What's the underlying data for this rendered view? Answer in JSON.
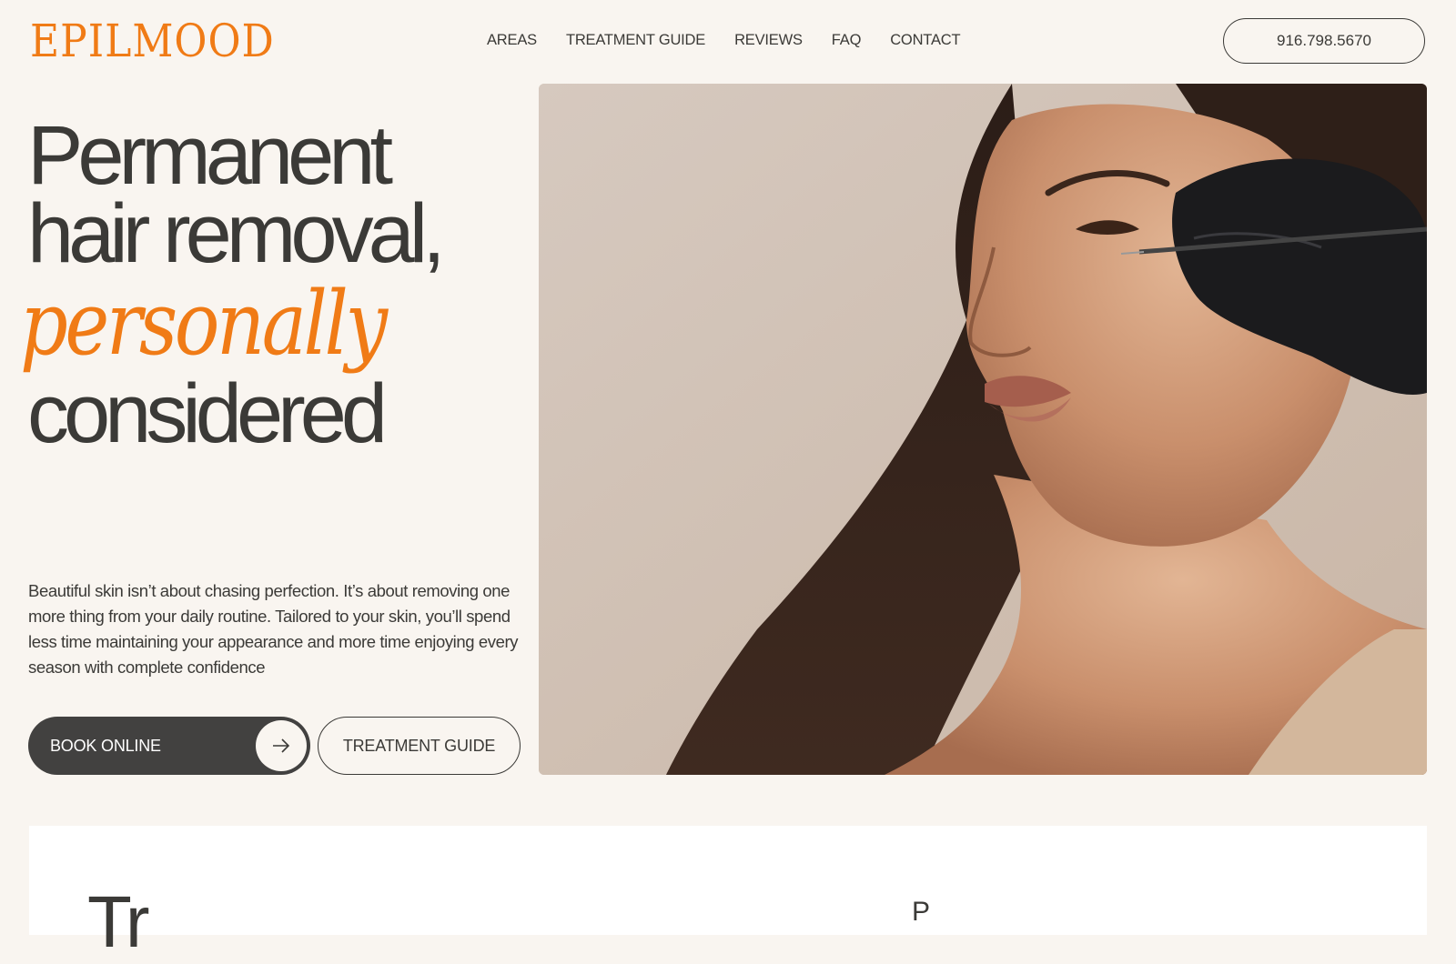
{
  "colors": {
    "background": "#f9f5f0",
    "ink": "#3b3a37",
    "accent": "#f07b16",
    "button_dark": "#424140"
  },
  "header": {
    "logo_text": "EPILMOOD",
    "nav": [
      "AREAS",
      "TREATMENT GUIDE",
      "REVIEWS",
      "FAQ",
      "CONTACT"
    ],
    "phone": "916.798.5670"
  },
  "hero": {
    "headline_line1": "Permanent",
    "headline_line2": "hair removal,",
    "headline_accent": "personally",
    "headline_line4": "considered",
    "lede": "Beautiful skin isn’t about chasing perfection. It’s about removing one more thing from your daily routine. Tailored to your skin, you’ll spend less time maintaining your appearance and more time enjoying every season with complete confidence",
    "book_label": "BOOK ONLINE",
    "book_icon": "arrow-right-icon",
    "guide_label": "TREATMENT GUIDE",
    "image_alt": "Woman receiving electrolysis treatment on cheek from gloved hand"
  },
  "lower_section": {
    "title": "Tr",
    "subtitle": "P"
  }
}
